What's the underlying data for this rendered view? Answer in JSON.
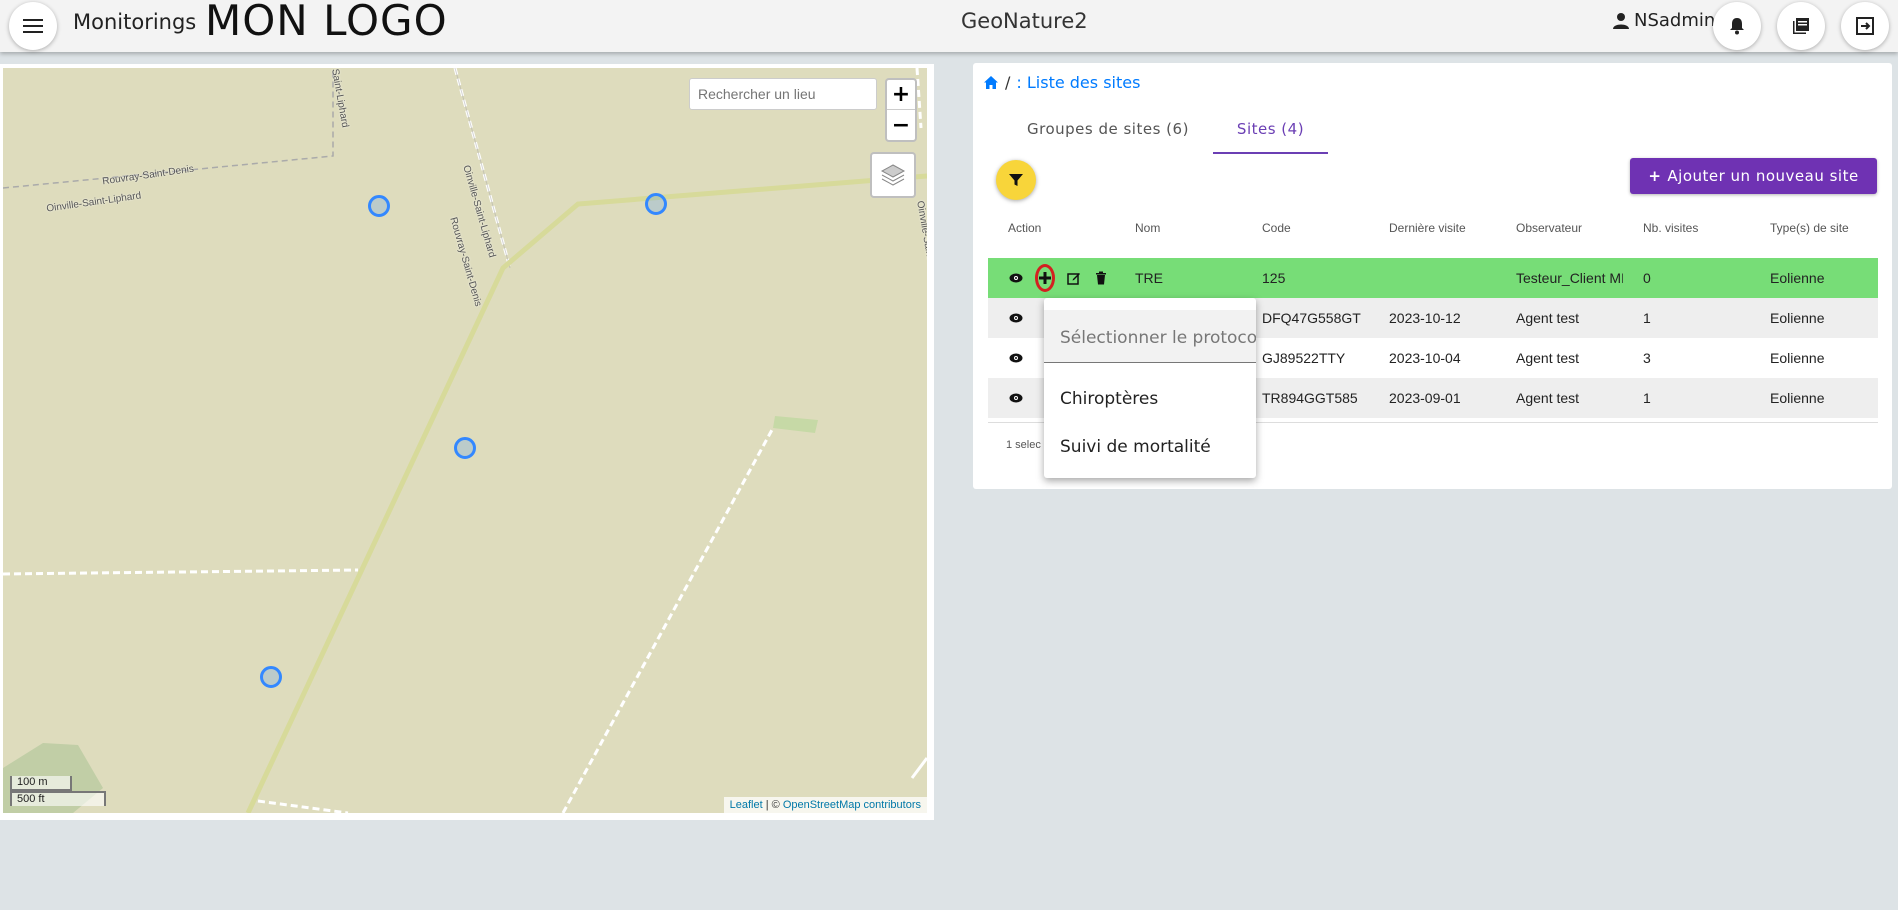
{
  "header": {
    "menu_icon": "menu-icon",
    "app_name": "Monitorings",
    "logo_text": "MON LOGO",
    "center_title": "GeoNature2",
    "user_name": "NSadmin",
    "icons": [
      "user-icon",
      "bell-icon",
      "book-icon",
      "logout-icon"
    ]
  },
  "map": {
    "search_placeholder": "Rechercher un lieu",
    "zoom_in": "+",
    "zoom_out": "−",
    "scale_metric": "100 m",
    "scale_imperial": "500 ft",
    "attribution_leaflet": "Leaflet",
    "attribution_sep": " | © ",
    "attribution_osm": "OpenStreetMap contributors",
    "labels": {
      "l1": "Rouvray-Saint-Denis",
      "l2": "Oinville-Saint-Liphard",
      "l3": "Rouvray-Saint-Denis",
      "l4": "Oinville-Saint-Liphard",
      "l5": "Saint-Liphard",
      "l6": "Oinville-Saint"
    }
  },
  "breadcrumb": {
    "home_icon": "home-icon",
    "separator": "/",
    "current": ": Liste des sites"
  },
  "tabs": [
    {
      "label": "Groupes de sites (6)"
    },
    {
      "label": "Sites (4)"
    }
  ],
  "filter_icon": "filter-icon",
  "add_button": {
    "icon": "+",
    "label": "Ajouter un nouveau site"
  },
  "table": {
    "headers": [
      "Action",
      "Nom",
      "Code",
      "Dernière visite",
      "Observateur",
      "Nb. visites",
      "Type(s) de site"
    ],
    "rows": [
      {
        "nom": "TRE",
        "code": "125",
        "date": "",
        "obs": "Testeur_Client MI",
        "nb": "0",
        "type": "Eolienne"
      },
      {
        "nom": "",
        "code": "DFQ47G558GT",
        "date": "2023-10-12",
        "obs": "Agent test",
        "nb": "1",
        "type": "Eolienne"
      },
      {
        "nom": "",
        "code": "GJ89522TTY",
        "date": "2023-10-04",
        "obs": "Agent test",
        "nb": "3",
        "type": "Eolienne"
      },
      {
        "nom": "",
        "code": "TR894GGT585",
        "date": "2023-09-01",
        "obs": "Agent test",
        "nb": "1",
        "type": "Eolienne"
      }
    ],
    "footer": "1 selec"
  },
  "dropdown": {
    "placeholder": "Sélectionner le protocole",
    "options": [
      "Chiroptères",
      "Suivi de mortalité"
    ]
  }
}
